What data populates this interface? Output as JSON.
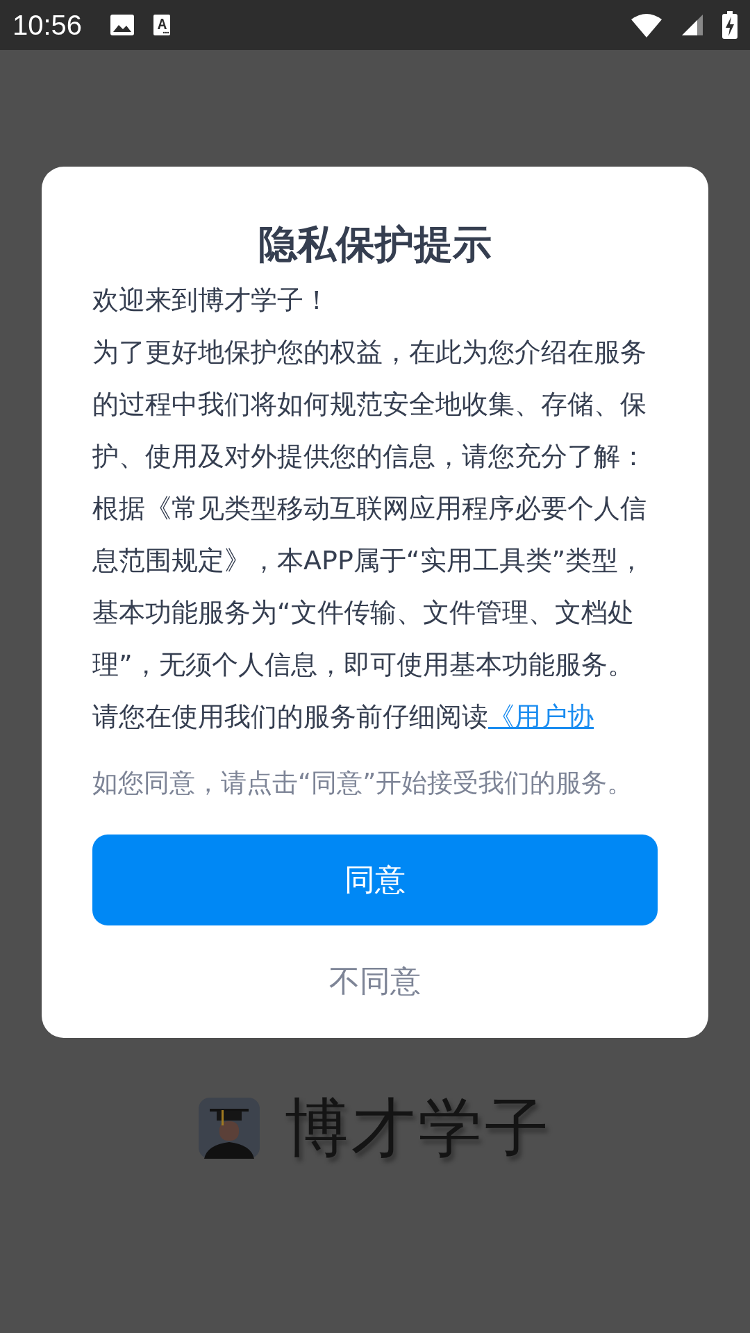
{
  "status_bar": {
    "time": "10:56"
  },
  "dialog": {
    "title": "隐私保护提示",
    "paragraphs": [
      "欢迎来到博才学子！",
      "为了更好地保护您的权益，在此为您介绍在服务的过程中我们将如何规范安全地收集、存储、保护、使用及对外提供您的信息，请您充分了解：",
      "根据《常见类型移动互联网应用程序必要个人信息范围规定》，本APP属于“实用工具类”类型，基本功能服务为“文件传输、文件管理、文档处理”，无须个人信息，即可使用基本功能服务。"
    ],
    "last_paragraph": {
      "text": "请您在使用我们的服务前仔细阅读",
      "link": "《用户协"
    },
    "consent_note": "如您同意，请点击“同意”开始接受我们的服务。",
    "buttons": [
      {
        "label": "同意",
        "kind": "primary"
      },
      {
        "label": "不同意",
        "kind": "text"
      }
    ]
  },
  "app": {
    "name": "博才学子"
  }
}
